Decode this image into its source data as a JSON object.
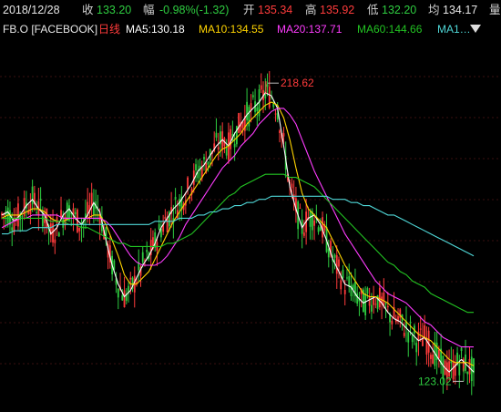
{
  "header": {
    "date": "2018/12/28",
    "close_label": "收",
    "close_value": "133.20",
    "change_label": "幅",
    "change_value": "-0.98%(-1.32)",
    "open_label": "开",
    "open_value": "135.34",
    "high_label": "高",
    "high_value": "135.92",
    "low_label": "低",
    "low_value": "132.20",
    "avg_label": "均",
    "avg_value": "134.17",
    "vol_label": "量"
  },
  "ma_bar": {
    "symbol": "FB.O [FACEBOOK]",
    "period": "日线",
    "ma5": "MA5:130.18",
    "ma10": "MA10:134.55",
    "ma20": "MA20:137.71",
    "ma60": "MA60:144.66",
    "ma_extra": "MA1…"
  },
  "colors": {
    "up": "#ff3b3b",
    "down": "#2ecc40",
    "ma5": "#ffffff",
    "ma10": "#ffd400",
    "ma20": "#ff3cff",
    "ma60": "#22c322",
    "ma120": "#4fd8d8"
  },
  "chart_data": {
    "type": "line",
    "subtype": "candlestick",
    "price_range": [
      115,
      230
    ],
    "annotations": [
      {
        "label": "218.62",
        "x": 218.62
      },
      {
        "label": "123.02",
        "x": 123.02
      }
    ],
    "series": [
      {
        "name": "MA5",
        "values": [
          176,
          177,
          174,
          176,
          179,
          181,
          178,
          176,
          170,
          172,
          176,
          178,
          175,
          173,
          176,
          180,
          177,
          168,
          160,
          154,
          150,
          152,
          156,
          160,
          163,
          167,
          172,
          175,
          178,
          180,
          183,
          186,
          190,
          192,
          195,
          198,
          200,
          198,
          202,
          205,
          208,
          210,
          212,
          215,
          214,
          210,
          198,
          185,
          178,
          172,
          175,
          176,
          173,
          168,
          162,
          158,
          154,
          153,
          150,
          148,
          149,
          150,
          148,
          145,
          143,
          142,
          140,
          138,
          136,
          137,
          134,
          131,
          128,
          126,
          128,
          130,
          128,
          126
        ]
      },
      {
        "name": "MA10",
        "values": [
          175,
          176,
          176,
          176,
          177,
          178,
          178,
          177,
          175,
          174,
          174,
          175,
          175,
          175,
          175,
          176,
          176,
          173,
          168,
          163,
          157,
          154,
          154,
          156,
          158,
          162,
          166,
          170,
          174,
          177,
          180,
          183,
          186,
          189,
          192,
          195,
          197,
          198,
          200,
          202,
          205,
          207,
          209,
          211,
          212,
          211,
          207,
          200,
          191,
          183,
          178,
          176,
          174,
          172,
          168,
          164,
          160,
          157,
          154,
          151,
          150,
          150,
          149,
          148,
          146,
          144,
          142,
          140,
          138,
          137,
          136,
          134,
          132,
          130,
          129,
          129,
          129,
          128
        ]
      },
      {
        "name": "MA20",
        "values": [
          172,
          173,
          174,
          175,
          175,
          176,
          176,
          176,
          176,
          176,
          175,
          175,
          175,
          175,
          175,
          175,
          175,
          174,
          172,
          169,
          166,
          163,
          161,
          160,
          160,
          160,
          161,
          163,
          166,
          169,
          173,
          176,
          179,
          182,
          185,
          188,
          191,
          193,
          195,
          198,
          200,
          202,
          205,
          207,
          209,
          210,
          210,
          208,
          205,
          200,
          195,
          190,
          186,
          182,
          178,
          174,
          170,
          167,
          164,
          161,
          158,
          155,
          153,
          151,
          150,
          149,
          148,
          146,
          144,
          142,
          141,
          139,
          137,
          136,
          135,
          134,
          134,
          134
        ]
      },
      {
        "name": "MA60",
        "values": [
          175,
          175,
          175,
          175,
          175,
          175,
          175,
          175,
          174,
          174,
          174,
          173,
          173,
          172,
          172,
          171,
          170,
          169,
          168,
          167,
          167,
          166,
          166,
          166,
          166,
          166,
          166,
          167,
          167,
          168,
          169,
          170,
          172,
          174,
          176,
          178,
          180,
          182,
          183,
          185,
          186,
          187,
          188,
          189,
          189,
          189,
          189,
          188,
          188,
          187,
          186,
          185,
          183,
          181,
          179,
          177,
          175,
          173,
          171,
          169,
          167,
          165,
          163,
          161,
          160,
          158,
          157,
          155,
          154,
          153,
          151,
          150,
          149,
          148,
          147,
          146,
          145,
          145
        ]
      },
      {
        "name": "MA120",
        "values": [
          170,
          170,
          171,
          171,
          171,
          172,
          172,
          172,
          172,
          173,
          173,
          173,
          173,
          173,
          173,
          173,
          173,
          173,
          173,
          173,
          173,
          173,
          173,
          173,
          173,
          174,
          174,
          174,
          174,
          175,
          175,
          175,
          176,
          176,
          177,
          177,
          178,
          178,
          179,
          179,
          180,
          180,
          181,
          181,
          182,
          182,
          182,
          182,
          182,
          182,
          182,
          182,
          182,
          182,
          181,
          181,
          181,
          180,
          180,
          179,
          179,
          178,
          177,
          176,
          176,
          175,
          174,
          173,
          172,
          171,
          170,
          169,
          168,
          167,
          166,
          165,
          164,
          163
        ]
      }
    ]
  }
}
